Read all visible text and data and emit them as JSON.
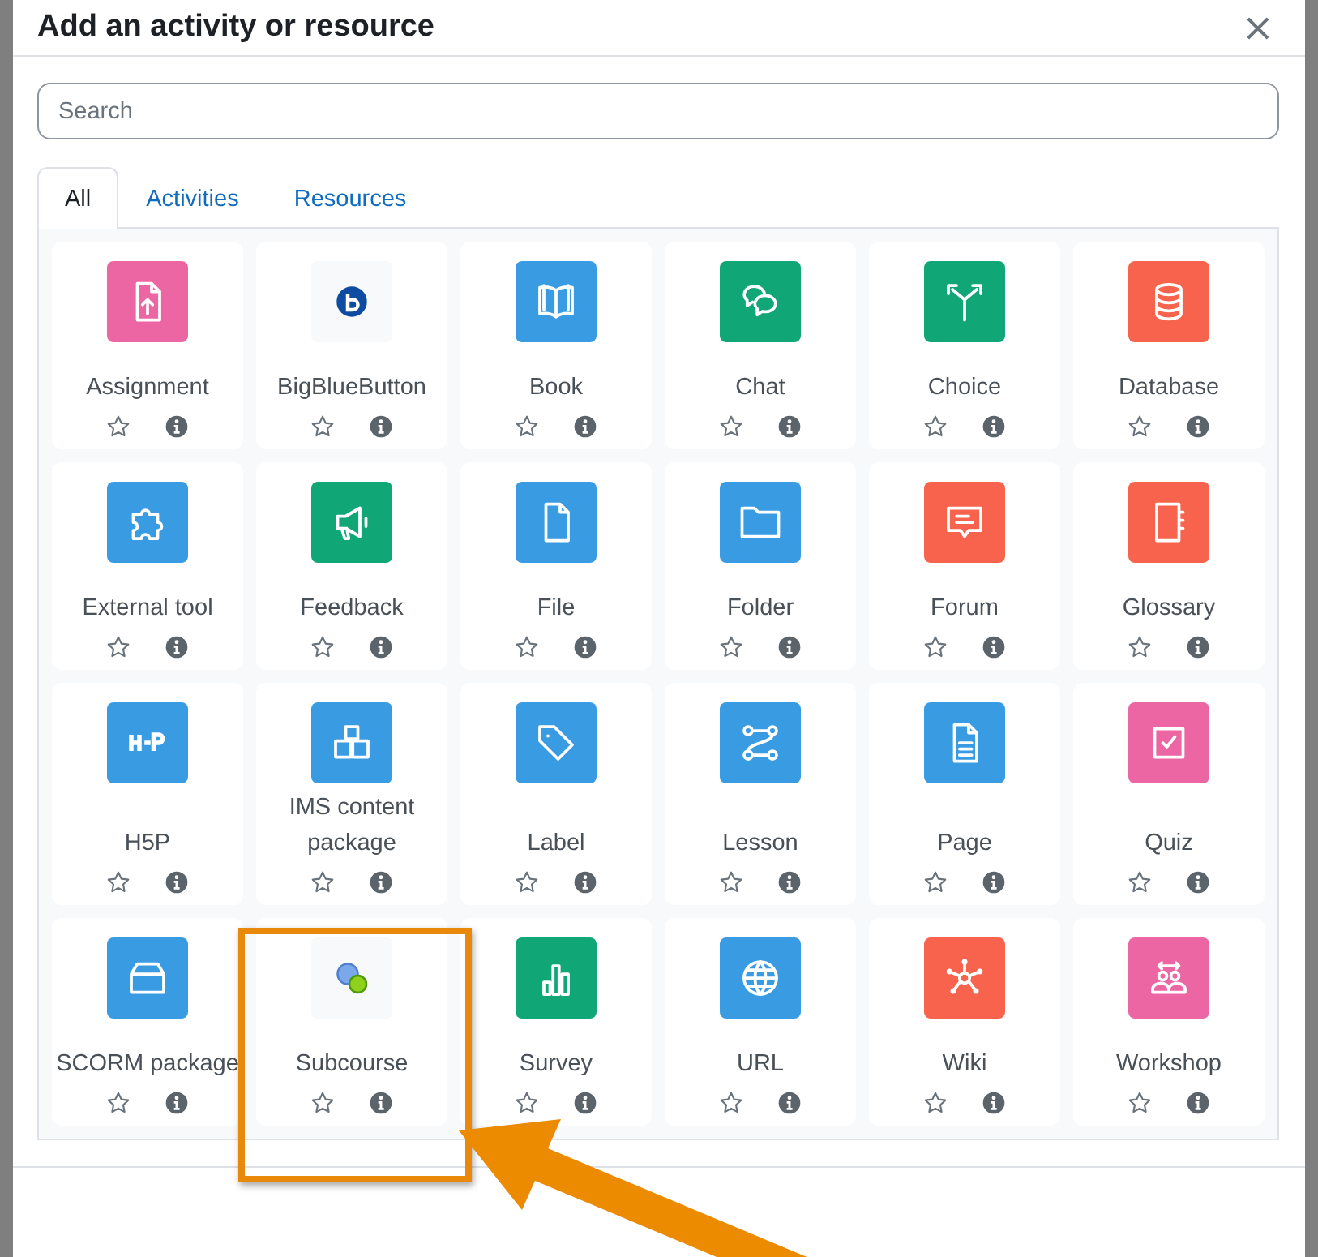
{
  "dialog": {
    "title": "Add an activity or resource",
    "close": "×"
  },
  "search": {
    "placeholder": "Search"
  },
  "tabs": [
    {
      "label": "All",
      "selected": true
    },
    {
      "label": "Activities",
      "selected": false
    },
    {
      "label": "Resources",
      "selected": false
    }
  ],
  "tiles": [
    {
      "name": "Assignment",
      "color": "#eb66a2",
      "starred": false
    },
    {
      "name": "BigBlueButton",
      "color": "#f8f9fa",
      "starred": false
    },
    {
      "name": "Book",
      "color": "#399be2",
      "starred": false
    },
    {
      "name": "Chat",
      "color": "#11a676",
      "starred": false
    },
    {
      "name": "Choice",
      "color": "#11a676",
      "starred": false
    },
    {
      "name": "Database",
      "color": "#f7634d",
      "starred": false
    },
    {
      "name": "External tool",
      "color": "#399be2",
      "starred": false
    },
    {
      "name": "Feedback",
      "color": "#11a676",
      "starred": false
    },
    {
      "name": "File",
      "color": "#399be2",
      "starred": false
    },
    {
      "name": "Folder",
      "color": "#399be2",
      "starred": false
    },
    {
      "name": "Forum",
      "color": "#f7634d",
      "starred": false
    },
    {
      "name": "Glossary",
      "color": "#f7634d",
      "starred": false
    },
    {
      "name": "H5P",
      "color": "#399be2",
      "starred": false
    },
    {
      "name": "IMS content package",
      "color": "#399be2",
      "starred": false
    },
    {
      "name": "Label",
      "color": "#399be2",
      "starred": false
    },
    {
      "name": "Lesson",
      "color": "#399be2",
      "starred": false
    },
    {
      "name": "Page",
      "color": "#399be2",
      "starred": false
    },
    {
      "name": "Quiz",
      "color": "#eb66a2",
      "starred": false
    },
    {
      "name": "SCORM package",
      "color": "#399be2",
      "starred": false
    },
    {
      "name": "Subcourse",
      "color": "#f8f9fa",
      "starred": false
    },
    {
      "name": "Survey",
      "color": "#11a676",
      "starred": false
    },
    {
      "name": "URL",
      "color": "#399be2",
      "starred": false
    },
    {
      "name": "Wiki",
      "color": "#f7634d",
      "starred": false
    },
    {
      "name": "Workshop",
      "color": "#eb66a2",
      "starred": false
    }
  ]
}
